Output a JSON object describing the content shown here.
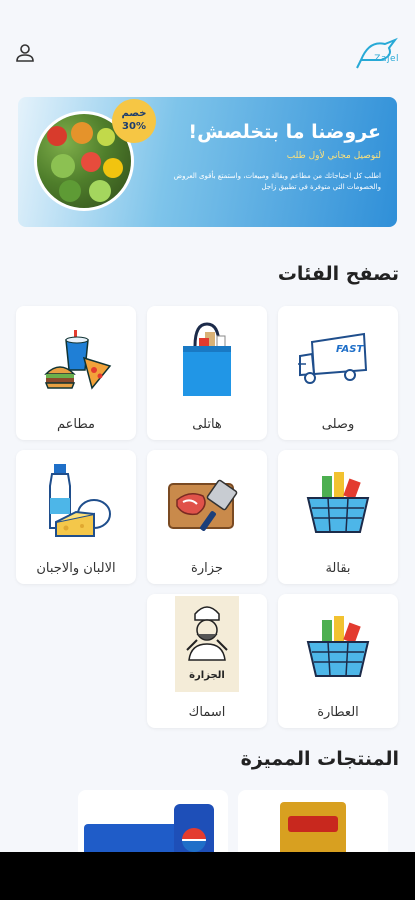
{
  "app": {
    "logo_text": "Zajel"
  },
  "banner": {
    "title": "عروضنا ما بتخلصش!",
    "subtitle": "لتوصيل مجاني لأول طلب",
    "description": "اطلب كل احتياجاتك من مطاعم وبقالة ومبيعات، واستمتع بأقوى العروض والخصومات التي متوفرة في تطبيق زاجل",
    "badge_line1": "خصم",
    "badge_line2": "30%"
  },
  "categories_section": {
    "title": "تصفح الفئات"
  },
  "categories": [
    {
      "label": "وصلى",
      "icon": "delivery-truck-icon"
    },
    {
      "label": "هاتلى",
      "icon": "shopping-bag-icon"
    },
    {
      "label": "مطاعم",
      "icon": "fast-food-icon"
    },
    {
      "label": "بقالة",
      "icon": "grocery-basket-icon"
    },
    {
      "label": "جزارة",
      "icon": "butcher-meat-icon"
    },
    {
      "label": "الالبان والاجبان",
      "icon": "dairy-icon"
    },
    {
      "label": "العطارة",
      "icon": "spices-basket-icon"
    },
    {
      "label": "اسماك",
      "icon": "fishmonger-icon"
    }
  ],
  "fish_icon_text": "الجزارة",
  "featured_section": {
    "title": "المنتجات المميزة"
  },
  "truck_text": "FAST"
}
